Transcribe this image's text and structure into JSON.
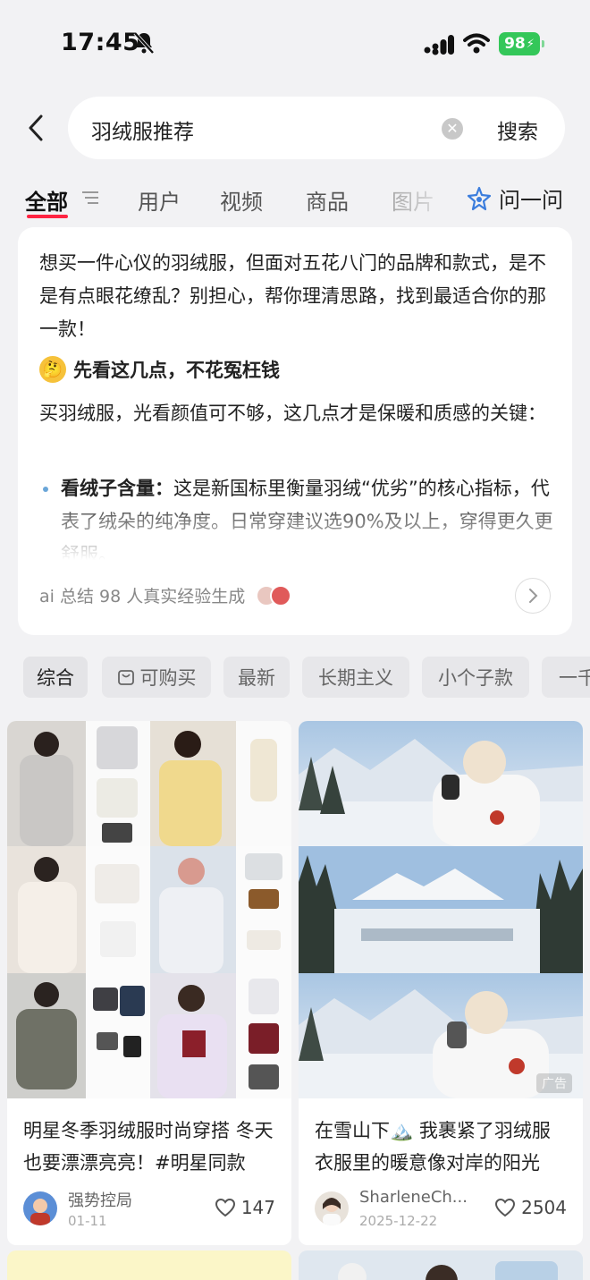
{
  "status": {
    "time": "17:45",
    "battery": "98"
  },
  "search": {
    "query": "羽绒服推荐",
    "button": "搜索"
  },
  "tabs": [
    {
      "label": "全部"
    },
    {
      "label": "用户"
    },
    {
      "label": "视频"
    },
    {
      "label": "商品"
    },
    {
      "label": "图片"
    }
  ],
  "ask": {
    "label": "问一问"
  },
  "ai_card": {
    "intro": "想买一件心仪的羽绒服，但面对五花八门的品牌和款式，是不是有点眼花缭乱？别担心，帮你理清思路，找到最适合你的那一款！",
    "heading": "先看这几点，不花冤枉钱",
    "para": "买羽绒服，光看颜值可不够，这几点才是保暖和质感的关键：",
    "bullet_label": "看绒子含量：",
    "bullet_text": "这是新国标里衡量羽绒“优劣”的核心指标，代表了绒朵的纯净度。日常穿建议选90%及以上，穿得更久更舒服。",
    "footer": "ai 总结 98 人真实经验生成"
  },
  "chips": [
    {
      "label": "综合"
    },
    {
      "label": "可购买"
    },
    {
      "label": "最新"
    },
    {
      "label": "长期主义"
    },
    {
      "label": "小个子款"
    },
    {
      "label": "一千"
    }
  ],
  "posts": [
    {
      "title": "明星冬季羽绒服时尚穿搭 冬天也要漂漂亮亮！#明星同款",
      "author": "强势控局",
      "date": "01-11",
      "likes": "147"
    },
    {
      "title": "在雪山下🏔️ 我裹紧了羽绒服 衣服里的暖意像对岸的阳光",
      "author": "SharleneCh...",
      "date": "2025-12-22",
      "likes": "2504",
      "ad": "广告"
    }
  ],
  "colors": {
    "accent": "#ff2442",
    "battery": "#34c759",
    "ask": "#3b7ddd"
  }
}
